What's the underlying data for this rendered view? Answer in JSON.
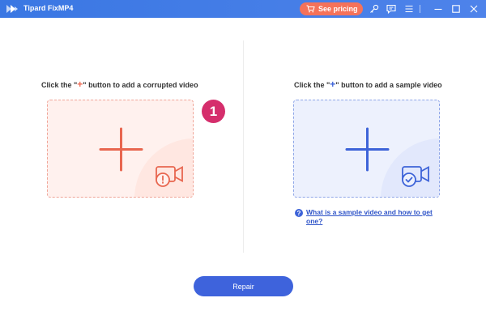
{
  "titlebar": {
    "app_title": "Tipard FixMP4",
    "pricing_label": "See pricing",
    "colors": {
      "bar": "#4a80e8",
      "pricing": "#f5725a"
    },
    "icons": [
      "key-icon",
      "feedback-icon",
      "menu-icon",
      "minimize-icon",
      "maximize-icon",
      "close-icon"
    ]
  },
  "left_panel": {
    "instruction_prefix": "Click the \"",
    "instruction_plus": "+",
    "instruction_suffix": "\" button to add a corrupted video",
    "badge": "1",
    "accent": "#ee6a52"
  },
  "right_panel": {
    "instruction_prefix": "Click the \"",
    "instruction_plus": "+",
    "instruction_suffix": "\" button to add a sample video",
    "help_icon": "?",
    "help_link": "What is a sample video and how to get one?",
    "accent": "#3d63d8"
  },
  "footer": {
    "repair_label": "Repair"
  }
}
